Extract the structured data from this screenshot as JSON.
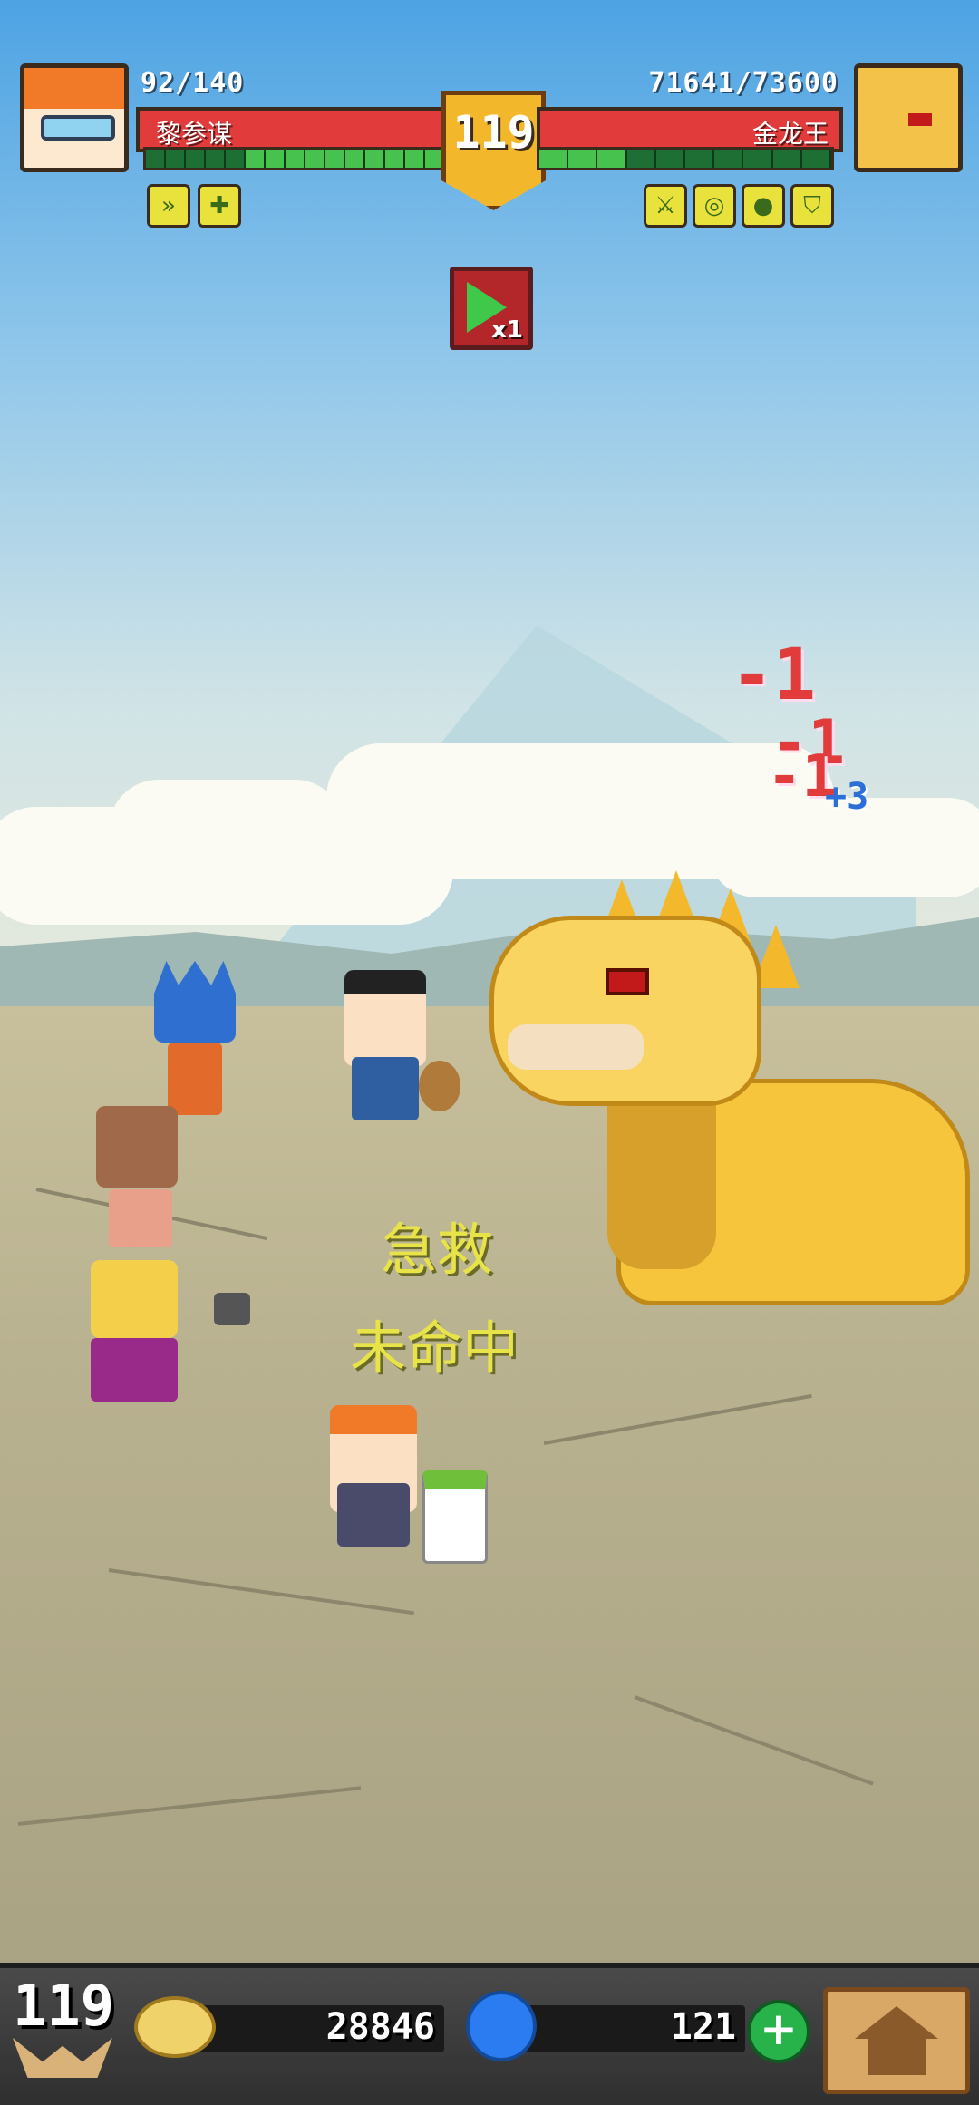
{
  "hud": {
    "player": {
      "name": "黎参谋",
      "hp_text": "92/140",
      "hp_fraction": 0.657,
      "energy_segments_total": 15,
      "energy_segments_filled": 10
    },
    "boss": {
      "name": "金龙王",
      "hp_text": "71641/73600",
      "hp_fraction": 0.973,
      "energy_segments_total": 10,
      "energy_segments_filled": 3
    },
    "stage_level": "119",
    "speed": {
      "label": "x1"
    },
    "player_buffs": [
      "dash-buff-icon",
      "heal-buff-icon"
    ],
    "boss_buffs": [
      "blade-buff-icon",
      "shield-buff-icon",
      "stone-buff-icon",
      "armor-buff-icon"
    ]
  },
  "battle": {
    "damage_numbers": [
      "-1",
      "-1",
      "-1"
    ],
    "heal_number": "+3",
    "status_lines": [
      "急救",
      "未命中"
    ]
  },
  "bottom": {
    "level": "119",
    "gold": "28846",
    "gems": "121",
    "add_label": "+"
  },
  "colors": {
    "hp_bar": "#e23b3b",
    "energy_on": "#47c24e",
    "badge": "#f3b72b",
    "status_text": "#e9e34a"
  }
}
